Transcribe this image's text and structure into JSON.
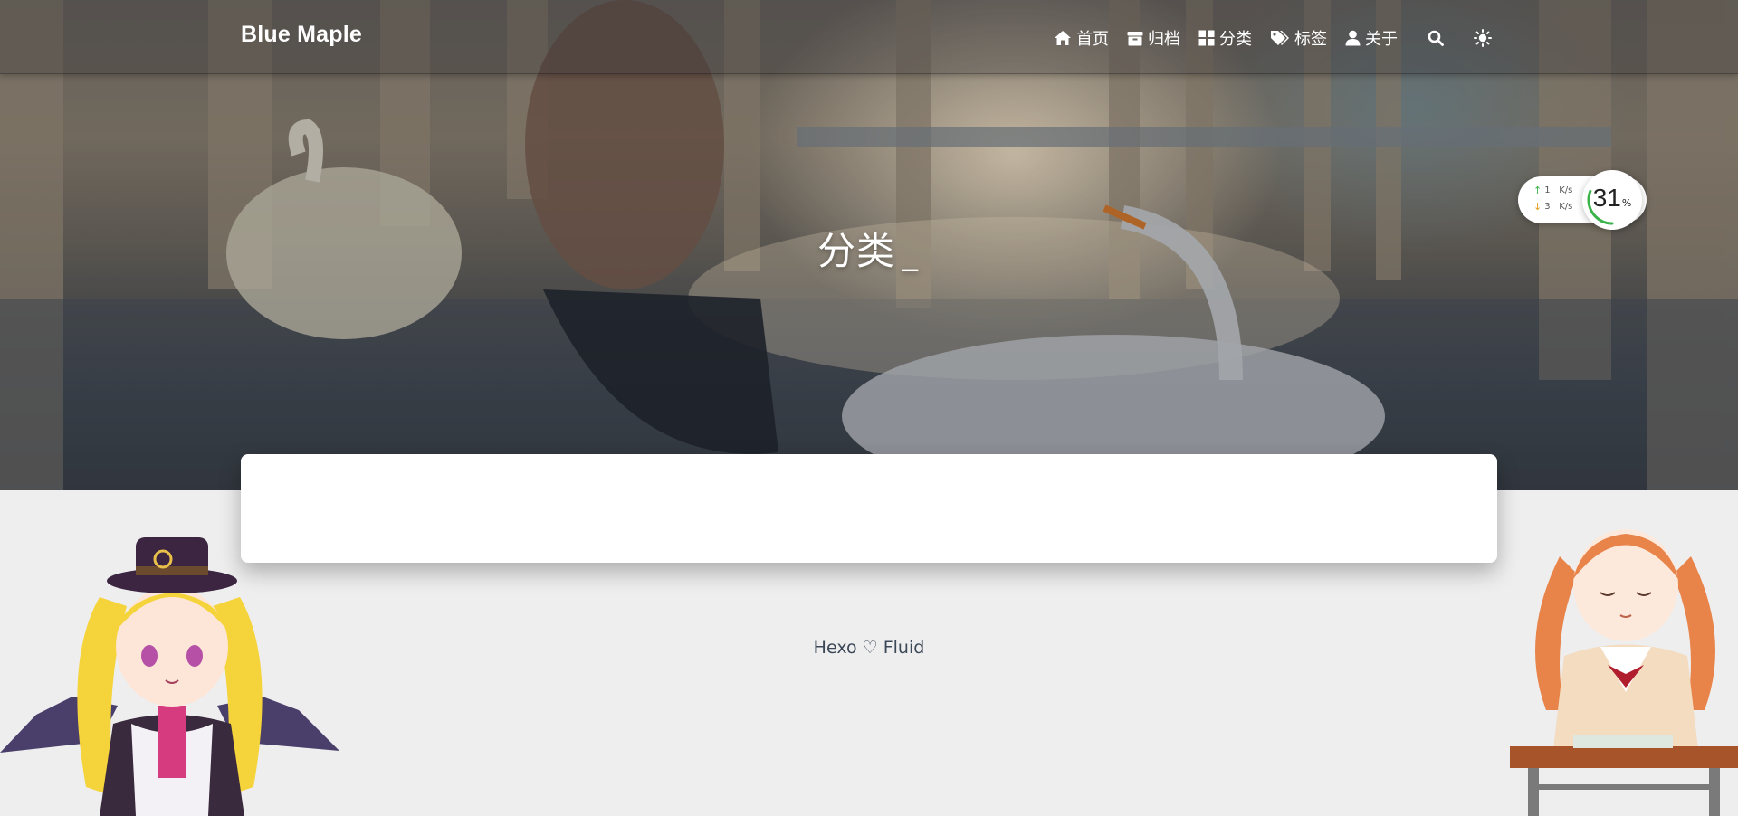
{
  "navbar": {
    "brand": "Blue Maple",
    "items": [
      {
        "label": "首页",
        "icon": "home-icon"
      },
      {
        "label": "归档",
        "icon": "archive-icon"
      },
      {
        "label": "分类",
        "icon": "category-icon"
      },
      {
        "label": "标签",
        "icon": "tags-icon"
      },
      {
        "label": "关于",
        "icon": "user-icon"
      }
    ],
    "search_icon": "search-icon",
    "theme_icon": "sun-icon"
  },
  "banner": {
    "subtitle": "分类",
    "cursor": "_"
  },
  "net_widget": {
    "upload": {
      "value": "1",
      "unit": "K/s"
    },
    "download": {
      "value": "3",
      "unit": "K/s"
    },
    "memory": {
      "value": "31",
      "unit": "%",
      "fraction": 0.31
    }
  },
  "footer": {
    "text": "Hexo ♡ Fluid"
  },
  "colors": {
    "page_bg": "#eeeeee",
    "card_bg": "#ffffff",
    "footer_text": "#3c4858",
    "upload_green": "#3bb34a",
    "download_orange": "#e69a1c"
  },
  "mascots": {
    "left": "vampire-girl-mascot",
    "right": "schoolgirl-desk-mascot"
  }
}
